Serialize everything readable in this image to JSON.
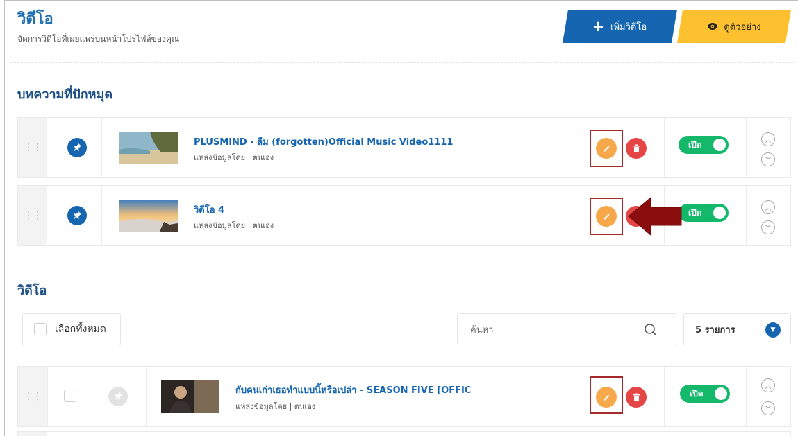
{
  "header": {
    "title": "วิดีโอ",
    "subtitle": "จัดการวิดีโอที่เผยแพร่บนหน้าโปรไฟล์ของคุณ",
    "add_button": "เพิ่มวิดีโอ",
    "preview_button": "ดูตัวอย่าง"
  },
  "pinned": {
    "title": "บทความที่ปักหมุด",
    "items": [
      {
        "title": "PLUSMIND - ลืม (forgotten)Official Music Video1111",
        "source": "แหล่งข้อมูลโดย | ตนเอง",
        "toggle": "เปิด"
      },
      {
        "title": "วิดีโอ 4",
        "source": "แหล่งข้อมูลโดย | ตนเอง",
        "toggle": "เปิด"
      }
    ]
  },
  "videos": {
    "title": "วิดีโอ",
    "select_all": "เลือกทั้งหมด",
    "search_placeholder": "ค้นหา",
    "per_page": "5 รายการ",
    "items": [
      {
        "title": "กับคนเก่าเธอทำแบบนี้หรือเปล่า - SEASON FIVE [OFFIC",
        "source": "แหล่งข้อมูลโดย | ตนเอง",
        "toggle": "เปิด"
      }
    ]
  },
  "colors": {
    "primary": "#1565b0",
    "accent_yellow": "#fdc02f",
    "edit_orange": "#f7a84b",
    "delete_red": "#e64545",
    "toggle_green": "#14b86b",
    "highlight": "#a52a2a",
    "annotation_arrow": "#8b0d0d"
  }
}
